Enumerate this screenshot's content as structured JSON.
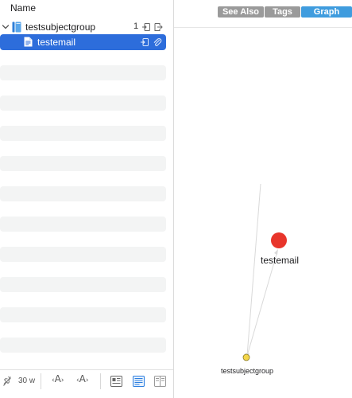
{
  "outline": {
    "column_header": "Name",
    "group": {
      "label": "testsubjectgroup",
      "count": "1",
      "icon": "folder-group-icon"
    },
    "selected_item": {
      "label": "testemail",
      "icon": "document-icon"
    }
  },
  "toolbar": {
    "word_count": "30 w",
    "decrease_font_label": "A",
    "increase_font_label": "A"
  },
  "inspector": {
    "tabs": [
      {
        "label": "See Also",
        "active": false
      },
      {
        "label": "Tags",
        "active": false
      },
      {
        "label": "Graph",
        "active": true
      }
    ]
  },
  "graph": {
    "nodes": [
      {
        "label": "testemail",
        "color": "#e8352b",
        "role": "current-document"
      },
      {
        "label": "testsubjectgroup",
        "color": "#f4d64a",
        "role": "parent-group"
      }
    ],
    "accent_color": "#2d6ddb",
    "active_tab_color": "#3f9cde"
  }
}
